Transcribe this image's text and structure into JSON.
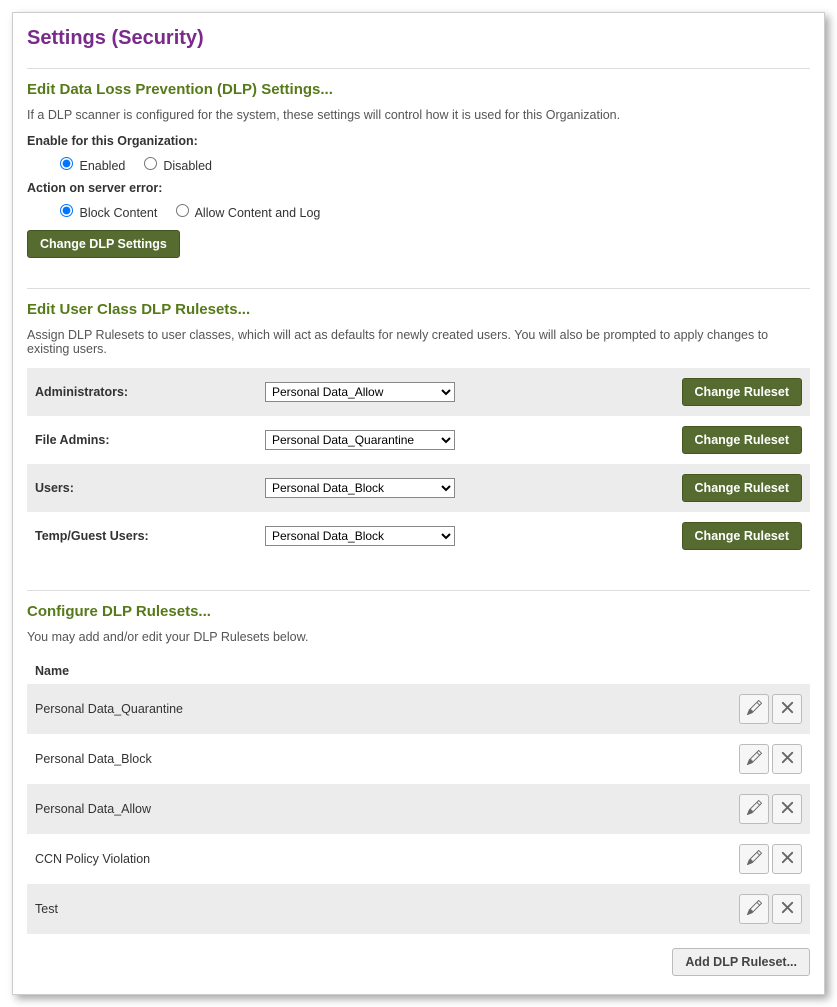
{
  "pageTitle": "Settings (Security)",
  "dlpSection": {
    "heading": "Edit Data Loss Prevention (DLP) Settings...",
    "description": "If a DLP scanner is configured for the system, these settings will control how it is used for this Organization.",
    "enableLabel": "Enable for this Organization:",
    "enabledOption": "Enabled",
    "disabledOption": "Disabled",
    "enableSelected": "enabled",
    "actionLabel": "Action on server error:",
    "blockOption": "Block Content",
    "allowOption": "Allow Content and Log",
    "actionSelected": "block",
    "changeButton": "Change DLP Settings"
  },
  "classSection": {
    "heading": "Edit User Class DLP Rulesets...",
    "description": "Assign DLP Rulesets to user classes, which will act as defaults for newly created users. You will also be prompted to apply changes to existing users.",
    "changeButton": "Change Ruleset",
    "rows": [
      {
        "label": "Administrators:",
        "selected": "Personal Data_Allow"
      },
      {
        "label": "File Admins:",
        "selected": "Personal Data_Quarantine"
      },
      {
        "label": "Users:",
        "selected": "Personal Data_Block"
      },
      {
        "label": "Temp/Guest Users:",
        "selected": "Personal Data_Block"
      }
    ],
    "options": [
      "Personal Data_Allow",
      "Personal Data_Quarantine",
      "Personal Data_Block",
      "CCN Policy Violation",
      "Test"
    ]
  },
  "rulesetSection": {
    "heading": "Configure DLP Rulesets...",
    "description": "You may add and/or edit your DLP Rulesets below.",
    "nameHeader": "Name",
    "rulesets": [
      "Personal Data_Quarantine",
      "Personal Data_Block",
      "Personal Data_Allow",
      "CCN Policy Violation",
      "Test"
    ],
    "addButton": "Add DLP Ruleset..."
  }
}
